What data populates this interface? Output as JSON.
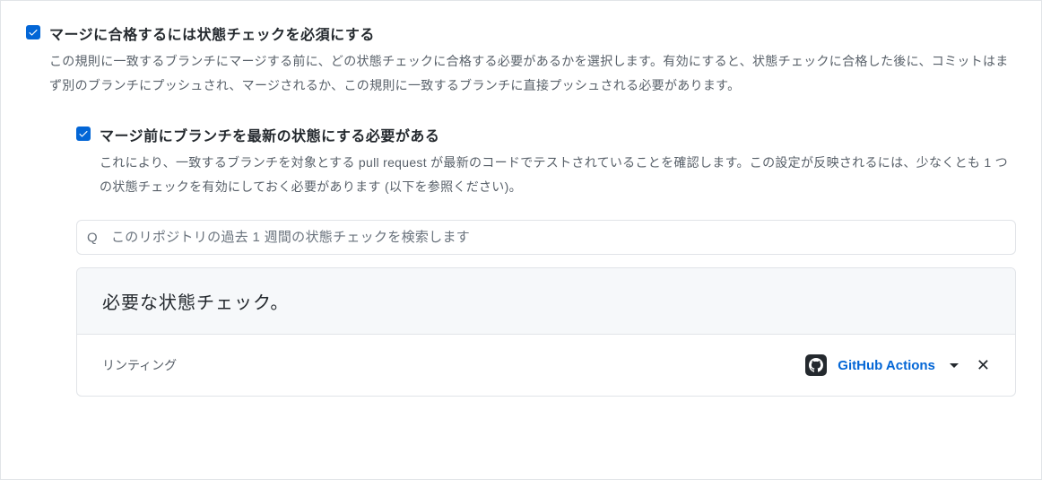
{
  "require_status_checks": {
    "title": "マージに合格するには状態チェックを必須にする",
    "desc": "この規則に一致するブランチにマージする前に、どの状態チェックに合格する必要があるかを選択します。有効にすると、状態チェックに合格した後に、コミットはまず別のブランチにプッシュされ、マージされるか、この規則に一致するブランチに直接プッシュされる必要があります。"
  },
  "require_up_to_date": {
    "title": "マージ前にブランチを最新の状態にする必要がある",
    "desc": "これにより、一致するブランチを対象とする pull request が最新のコードでテストされていることを確認します。この設定が反映されるには、少なくとも 1 つの状態チェックを有効にしておく必要があります (以下を参照ください)。"
  },
  "search": {
    "icon_char": "Q",
    "placeholder": "このリポジトリの過去 1 週間の状態チェックを検索します"
  },
  "required_checks": {
    "header": "必要な状態チェック。",
    "items": [
      {
        "name": "リンティング",
        "source": "GitHub Actions"
      }
    ]
  }
}
